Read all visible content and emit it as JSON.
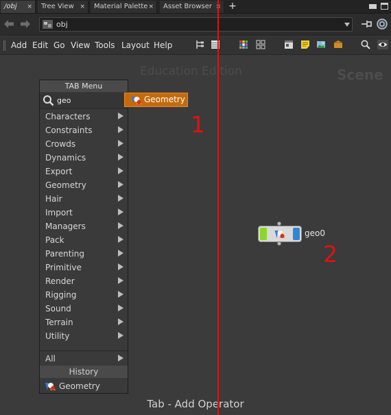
{
  "tabs": [
    {
      "label": "/obj",
      "active": true
    },
    {
      "label": "Tree View",
      "active": false
    },
    {
      "label": "Material Palette",
      "active": false
    },
    {
      "label": "Asset Browser",
      "active": false
    }
  ],
  "tab_close_glyph": "×",
  "tab_add_glyph": "+",
  "path": {
    "value": "obj"
  },
  "menubar": {
    "items": [
      "Add",
      "Edit",
      "Go",
      "View",
      "Tools",
      "Layout",
      "Help"
    ]
  },
  "network": {
    "edition_watermark": "Education Edition",
    "context_label": "Scene",
    "footer_hint": "Tab - Add Operator"
  },
  "tab_menu": {
    "title": "TAB Menu",
    "search_value": "geo",
    "categories": [
      "Characters",
      "Constraints",
      "Crowds",
      "Dynamics",
      "Export",
      "Geometry",
      "Hair",
      "Import",
      "Managers",
      "Pack",
      "Parenting",
      "Primitive",
      "Render",
      "Rigging",
      "Sound",
      "Terrain",
      "Utility"
    ],
    "all_label": "All",
    "history_title": "History",
    "history_items": [
      "Geometry"
    ]
  },
  "search_result": {
    "label": "Geometry"
  },
  "node": {
    "name": "geo0"
  },
  "annotations": {
    "marker_1": "1",
    "marker_2": "2",
    "color": "#e01212"
  },
  "colors": {
    "accent": "#c56a0d",
    "background": "#3b3b3b"
  }
}
